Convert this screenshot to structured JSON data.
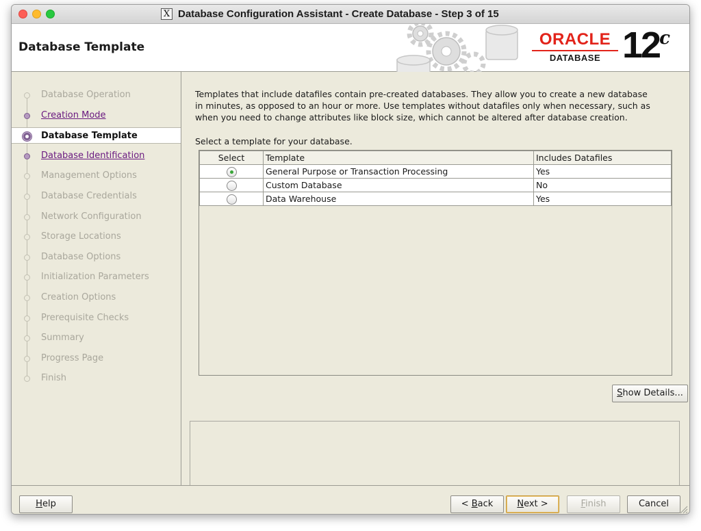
{
  "window": {
    "title": "Database Configuration Assistant - Create Database - Step 3 of 15",
    "title_icon": "X"
  },
  "banner": {
    "page_title": "Database Template",
    "logo_word": "ORACLE",
    "logo_sub": "DATABASE",
    "version": "12",
    "version_sup": "c"
  },
  "sidebar": {
    "steps": [
      {
        "label": "Database Operation",
        "state": "disabled"
      },
      {
        "label": "Creation Mode",
        "state": "done"
      },
      {
        "label": "Database Template",
        "state": "current"
      },
      {
        "label": "Database Identification",
        "state": "done"
      },
      {
        "label": "Management Options",
        "state": "disabled"
      },
      {
        "label": "Database Credentials",
        "state": "disabled"
      },
      {
        "label": "Network Configuration",
        "state": "disabled"
      },
      {
        "label": "Storage Locations",
        "state": "disabled"
      },
      {
        "label": "Database Options",
        "state": "disabled"
      },
      {
        "label": "Initialization Parameters",
        "state": "disabled"
      },
      {
        "label": "Creation Options",
        "state": "disabled"
      },
      {
        "label": "Prerequisite Checks",
        "state": "disabled"
      },
      {
        "label": "Summary",
        "state": "disabled"
      },
      {
        "label": "Progress Page",
        "state": "disabled"
      },
      {
        "label": "Finish",
        "state": "disabled"
      }
    ]
  },
  "main": {
    "description_lines": [
      "Templates that include datafiles contain pre-created databases. They allow you to create a new database",
      "in minutes, as opposed to an hour or more. Use templates without datafiles only when necessary, such as",
      "when you need to change attributes like block size, which cannot be altered after database creation."
    ],
    "select_label": "Select a template for your database.",
    "table": {
      "headers": [
        "Select",
        "Template",
        "Includes Datafiles"
      ],
      "rows": [
        {
          "selected": true,
          "template": "General Purpose or Transaction Processing",
          "datafiles": "Yes"
        },
        {
          "selected": false,
          "template": "Custom Database",
          "datafiles": "No"
        },
        {
          "selected": false,
          "template": "Data Warehouse",
          "datafiles": "Yes"
        }
      ]
    },
    "show_details": {
      "mnemonic": "S",
      "rest": "how Details..."
    }
  },
  "footer": {
    "help": {
      "mnemonic": "H",
      "rest": "elp"
    },
    "back": {
      "prefix": "< ",
      "mnemonic": "B",
      "rest": "ack"
    },
    "next": {
      "mnemonic": "N",
      "rest": "ext >"
    },
    "finish": {
      "mnemonic": "F",
      "rest": "inish"
    },
    "cancel": "Cancel"
  },
  "colors": {
    "window_bg": "#eceadc",
    "oracle_red": "#e2231a",
    "link_purple": "#6a1a80",
    "radio_selected": "#3aa63a"
  }
}
